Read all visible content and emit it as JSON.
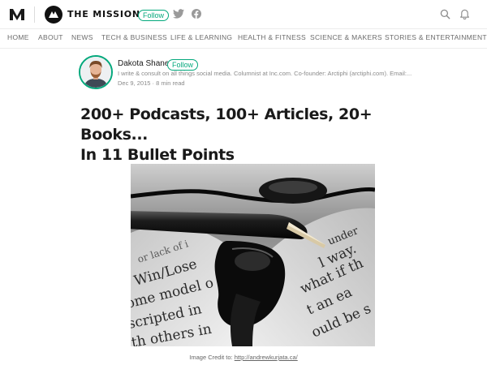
{
  "topbar": {
    "publication": "THE MISSION",
    "follow_label": "Follow"
  },
  "nav": [
    "HOME",
    "ABOUT",
    "NEWS",
    "TECH & BUSINESS",
    "LIFE & LEARNING",
    "HEALTH & FITNESS",
    "SCIENCE & MAKERS",
    "STORIES & ENTERTAINMENT"
  ],
  "author": {
    "name": "Dakota Shane",
    "follow_label": "Follow",
    "bio": "I write & consult on all things social media. Columnist at Inc.com. Co-founder: Arctiphi (arctiphi.com). Email:...",
    "date": "Dec 9, 2015",
    "separator": "·",
    "read_time": "8 min read"
  },
  "article": {
    "title_line1": "200+ Podcasts, 100+ Articles, 20+ Books...",
    "title_line2": "In 11 Bullet Points",
    "caption_prefix": "Image Credit to:",
    "caption_link": "http://andrewkurjata.ca/"
  },
  "hero_text": {
    "l1": "Win/Lose",
    "l2": "ome model o",
    "l3": "scripted in",
    "l4": "th others in",
    "l5": "or lack of i",
    "r1": "under",
    "r2": "l way.",
    "r3": "what if th",
    "r4": "t an ea",
    "r5": "ould be s"
  },
  "colors": {
    "accent": "#03a87c"
  }
}
